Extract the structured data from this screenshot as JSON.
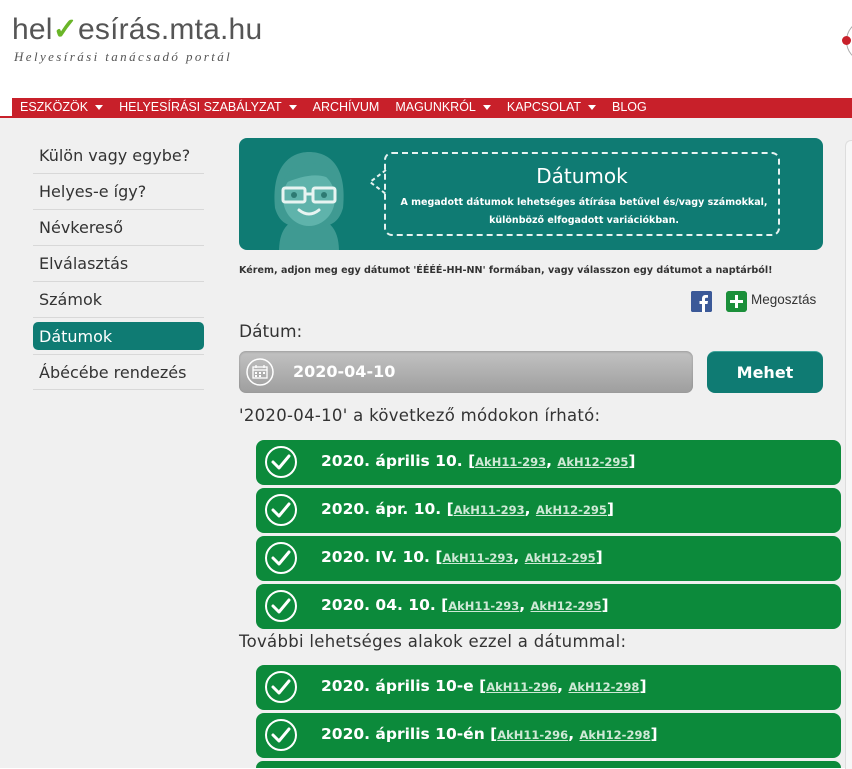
{
  "header": {
    "logo_left": "hel",
    "logo_right": "esírás.mta.hu",
    "tagline": "Helyesírási tanácsadó portál"
  },
  "nav": [
    {
      "label": "ESZKÖZÖK",
      "dropdown": true
    },
    {
      "label": "HELYESÍRÁSI SZABÁLYZAT",
      "dropdown": true
    },
    {
      "label": "ARCHÍVUM",
      "dropdown": false
    },
    {
      "label": "MAGUNKRÓL",
      "dropdown": true
    },
    {
      "label": "KAPCSOLAT",
      "dropdown": true
    },
    {
      "label": "BLOG",
      "dropdown": false
    }
  ],
  "sidebar": {
    "items": [
      {
        "label": "Külön vagy egybe?"
      },
      {
        "label": "Helyes-e így?"
      },
      {
        "label": "Névkereső"
      },
      {
        "label": "Elválasztás"
      },
      {
        "label": "Számok"
      },
      {
        "label": "Dátumok",
        "active": true
      },
      {
        "label": "Ábécébe rendezés"
      }
    ]
  },
  "banner": {
    "title": "Dátumok",
    "description": "A megadott dátumok lehetséges átírása betűvel és/vagy számokkal, különböző elfogadott variációkban."
  },
  "instruction": "Kérem, adjon meg egy dátumot 'ÉÉÉÉ-HH-NN' formában, vagy válasszon egy dátumot a naptárból!",
  "share": {
    "label": "Megosztás"
  },
  "form": {
    "date_label": "Dátum:",
    "date_value": "2020-04-10",
    "submit_label": "Mehet"
  },
  "results_title": "'2020-04-10' a következő módokon írható:",
  "results": [
    {
      "text": "2020. április 10.",
      "refs": [
        "AkH11-293",
        "AkH12-295"
      ]
    },
    {
      "text": "2020. ápr. 10.",
      "refs": [
        "AkH11-293",
        "AkH12-295"
      ]
    },
    {
      "text": "2020. IV. 10.",
      "refs": [
        "AkH11-293",
        "AkH12-295"
      ]
    },
    {
      "text": "2020. 04. 10.",
      "refs": [
        "AkH11-293",
        "AkH12-295"
      ]
    }
  ],
  "more_title": "További lehetséges alakok ezzel a dátummal:",
  "more_results": [
    {
      "text": "2020. április 10-e",
      "refs": [
        "AkH11-296",
        "AkH12-298"
      ]
    },
    {
      "text": "2020. április 10-én",
      "refs": [
        "AkH11-296",
        "AkH12-298"
      ]
    }
  ],
  "colors": {
    "brand_red": "#c8202a",
    "teal": "#0f7b73",
    "result_green": "#0c8a3b",
    "logo_check": "#6ab528"
  }
}
